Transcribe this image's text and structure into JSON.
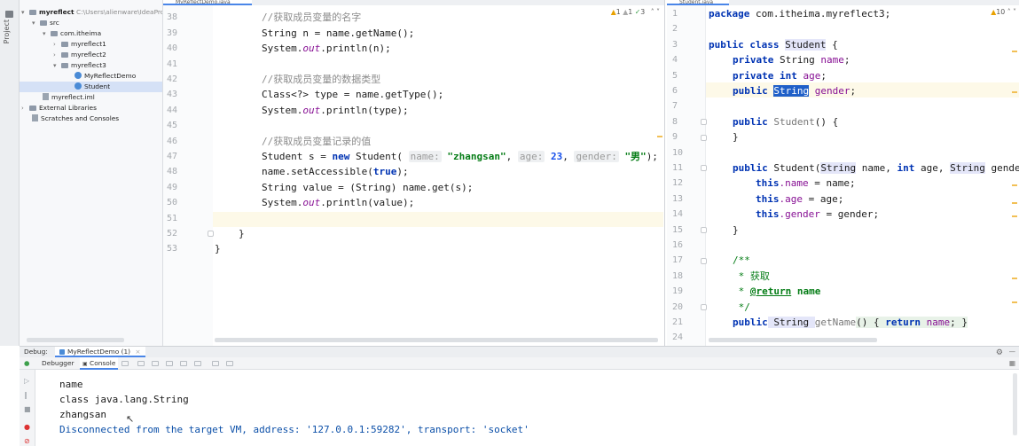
{
  "sidebar": {
    "tool_window_label": "Project"
  },
  "project_tree": {
    "items": [
      {
        "label": "myreflect",
        "extra": "C:\\Users\\alienware\\IdeaProj"
      },
      {
        "label": "src"
      },
      {
        "label": "com.itheima"
      },
      {
        "label": "myreflect1"
      },
      {
        "label": "myreflect2"
      },
      {
        "label": "myreflect3"
      },
      {
        "label": "MyReflectDemo"
      },
      {
        "label": "Student"
      },
      {
        "label": "myreflect.iml"
      },
      {
        "label": "External Libraries"
      },
      {
        "label": "Scratches and Consoles"
      }
    ]
  },
  "editor_left": {
    "tab": "MyReflectDemo.java",
    "inspections": {
      "warn1": "1",
      "warn2": "1",
      "ok": "3"
    },
    "line_numbers": [
      "38",
      "39",
      "40",
      "41",
      "42",
      "43",
      "44",
      "45",
      "46",
      "47",
      "48",
      "49",
      "50",
      "51",
      "52",
      "53"
    ],
    "lines": {
      "l38": "//获取成员变量的名字",
      "l39": "String n = name.getName();",
      "l40_a": "System.",
      "l40_b": "out",
      "l40_c": ".println(n);",
      "l42": "//获取成员变量的数据类型",
      "l43": "Class<?> type = name.getType();",
      "l44_a": "System.",
      "l44_b": "out",
      "l44_c": ".println(type);",
      "l46": "//获取成员变量记录的值",
      "l47_a": "Student s = ",
      "l47_kw": "new",
      "l47_b": " Student( ",
      "l47_h1": "name:",
      "l47_s1": "\"zhangsan\"",
      "l47_c": ", ",
      "l47_h2": "age:",
      "l47_n": " 23",
      "l47_d": ", ",
      "l47_h3": "gender:",
      "l47_s2": "\"男\"",
      "l47_e": ");",
      "l48_a": "name.setAccessible(",
      "l48_kw": "true",
      "l48_b": ");",
      "l49": "String value = (String) name.get(s);",
      "l50_a": "System.",
      "l50_b": "out",
      "l50_c": ".println(value);",
      "l52": "}",
      "l53": "}"
    }
  },
  "editor_right": {
    "tab": "Student.java",
    "inspections": {
      "warn": "10"
    },
    "line_numbers": [
      "1",
      "2",
      "3",
      "4",
      "5",
      "6",
      "7",
      "8",
      "9",
      "10",
      "11",
      "12",
      "13",
      "14",
      "15",
      "16",
      "17",
      "18",
      "19",
      "20",
      "21",
      "24"
    ],
    "lines": {
      "r1_kw": "package",
      "r1": " com.itheima.myreflect3;",
      "r3_kw1": "public class",
      "r3_cls": "Student",
      "r3_b": " {",
      "r4_kw": "private",
      "r4_t": " String ",
      "r4_f": "name",
      "r4_e": ";",
      "r5_kw": "private",
      "r5_t": " int ",
      "r5_f": "age",
      "r5_e": ";",
      "r6_kw": "public",
      "r6_t": "String",
      "r6_f": "gender",
      "r6_e": ";",
      "r8_kw": "public",
      "r8_c": " Student",
      "r8_e": "() {",
      "r9": "}",
      "r11_kw": "public",
      "r11_a": " Student(",
      "r11_t1": "String",
      "r11_b": " name, ",
      "r11_kw2": "int",
      "r11_c": " age, ",
      "r11_t2": "String",
      "r11_d": " gende",
      "r12_kw": "this",
      "r12_f": ".name",
      "r12_e": " = name;",
      "r13_kw": "this",
      "r13_f": ".age",
      "r13_e": " = age;",
      "r14_kw": "this",
      "r14_f": ".gender",
      "r14_e": " = gender;",
      "r15": "}",
      "r17": "/**",
      "r18": " * 获取",
      "r19_a": " * ",
      "r19_tag": "@return",
      "r19_b": " name",
      "r20": " */",
      "r21_kw": "public",
      "r21_t": " String ",
      "r21_fn": "getName",
      "r21_a": "() { ",
      "r21_kw2": "return",
      "r21_f": " name",
      "r21_e": "; }"
    }
  },
  "debug": {
    "label": "Debug:",
    "session": "MyReflectDemo (1)",
    "tabs": {
      "debugger": "Debugger",
      "console": "Console"
    },
    "output": [
      "name",
      "class java.lang.String",
      "zhangsan",
      "Disconnected from the target VM, address: '127.0.0.1:59282', transport: 'socket'"
    ]
  },
  "colors": {
    "keyword": "#0033b3",
    "string": "#067d17",
    "field": "#871094",
    "selection": "#2060c8"
  }
}
